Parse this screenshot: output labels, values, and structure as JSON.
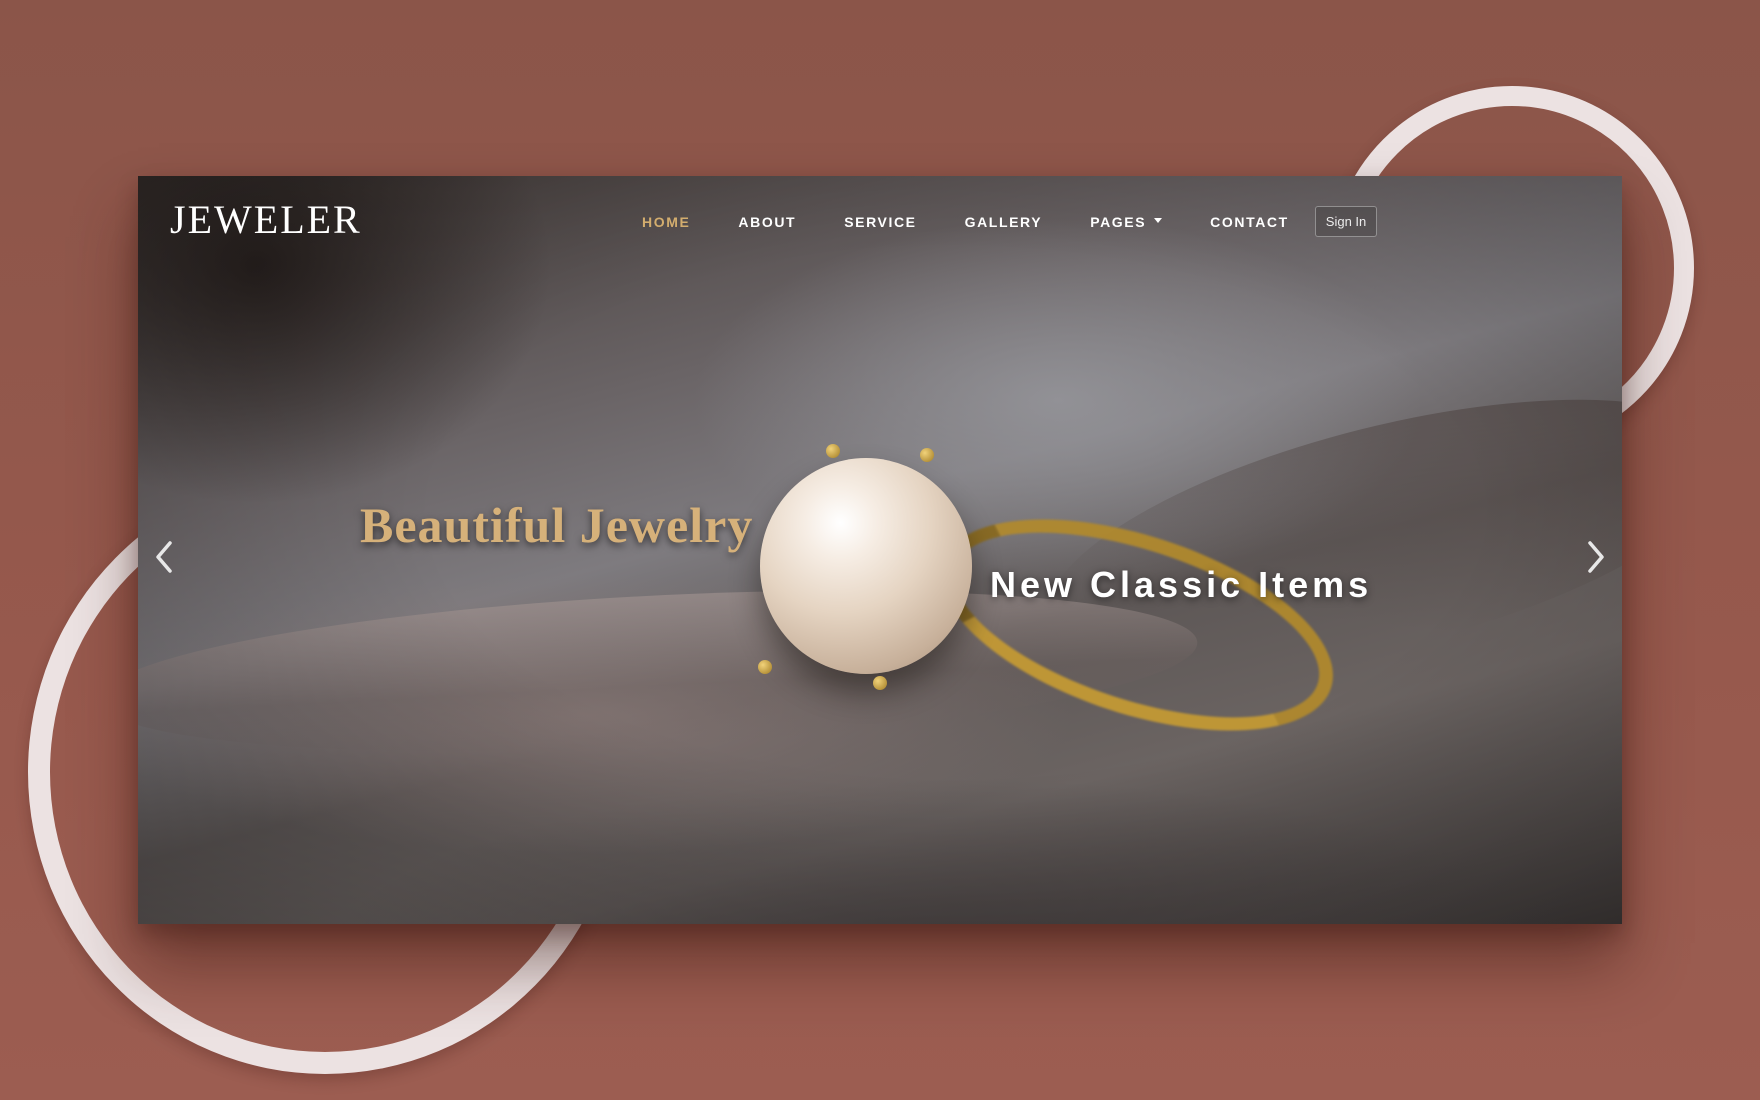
{
  "brand": {
    "name": "JEWELER"
  },
  "nav": {
    "items": [
      {
        "label": "HOME",
        "active": true
      },
      {
        "label": "ABOUT",
        "active": false
      },
      {
        "label": "SERVICE",
        "active": false
      },
      {
        "label": "GALLERY",
        "active": false
      },
      {
        "label": "PAGES",
        "active": false,
        "has_dropdown": true
      },
      {
        "label": "CONTACT",
        "active": false
      }
    ],
    "signin_label": "Sign In"
  },
  "hero": {
    "primary_caption": "Beautiful Jewelry",
    "secondary_caption": "New Classic Items",
    "prev_icon": "chevron-left-icon",
    "next_icon": "chevron-right-icon"
  },
  "colors": {
    "background": "#8b5549",
    "ring": "#ece2e2",
    "accent_gold": "#d3ad6e",
    "text_white": "#ffffff"
  }
}
